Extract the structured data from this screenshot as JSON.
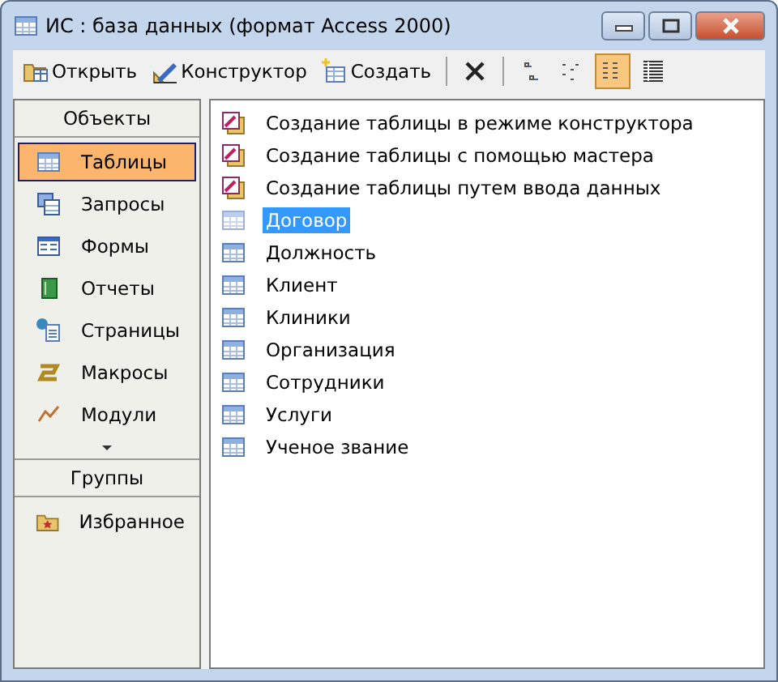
{
  "window": {
    "title": "ИС : база данных (формат Access 2000)"
  },
  "toolbar": {
    "buttons": [
      {
        "kind": "open",
        "label": "Открыть"
      },
      {
        "kind": "design",
        "label": "Конструктор"
      },
      {
        "kind": "new",
        "label": "Создать"
      },
      {
        "kind": "separator"
      },
      {
        "kind": "delete"
      },
      {
        "kind": "separator"
      },
      {
        "kind": "large-icons",
        "selected": false
      },
      {
        "kind": "small-icons",
        "selected": false
      },
      {
        "kind": "list",
        "selected": true
      },
      {
        "kind": "details",
        "selected": false
      }
    ]
  },
  "sidebar": {
    "objects_header": "Объекты",
    "items": [
      {
        "kind": "tables",
        "label": "Таблицы",
        "selected": true
      },
      {
        "kind": "queries",
        "label": "Запросы",
        "selected": false
      },
      {
        "kind": "forms",
        "label": "Формы",
        "selected": false
      },
      {
        "kind": "reports",
        "label": "Отчеты",
        "selected": false
      },
      {
        "kind": "pages",
        "label": "Страницы",
        "selected": false
      },
      {
        "kind": "macros",
        "label": "Макросы",
        "selected": false
      },
      {
        "kind": "modules",
        "label": "Модули",
        "selected": false
      }
    ],
    "groups_header": "Группы",
    "groups": [
      {
        "label": "Избранное",
        "selected": false
      }
    ]
  },
  "list": {
    "items": [
      {
        "kind": "shortcut",
        "label": "Создание таблицы в режиме конструктора",
        "selected": false
      },
      {
        "kind": "shortcut",
        "label": "Создание таблицы с помощью мастера",
        "selected": false
      },
      {
        "kind": "shortcut",
        "label": "Создание таблицы путем ввода данных",
        "selected": false
      },
      {
        "kind": "table",
        "label": "Договор",
        "selected": true
      },
      {
        "kind": "table",
        "label": "Должность",
        "selected": false
      },
      {
        "kind": "table",
        "label": "Клиент",
        "selected": false
      },
      {
        "kind": "table",
        "label": "Клиники",
        "selected": false
      },
      {
        "kind": "table",
        "label": "Организация",
        "selected": false
      },
      {
        "kind": "table",
        "label": "Сотрудники",
        "selected": false
      },
      {
        "kind": "table",
        "label": "Услуги",
        "selected": false
      },
      {
        "kind": "table",
        "label": "Ученое звание",
        "selected": false
      }
    ]
  }
}
